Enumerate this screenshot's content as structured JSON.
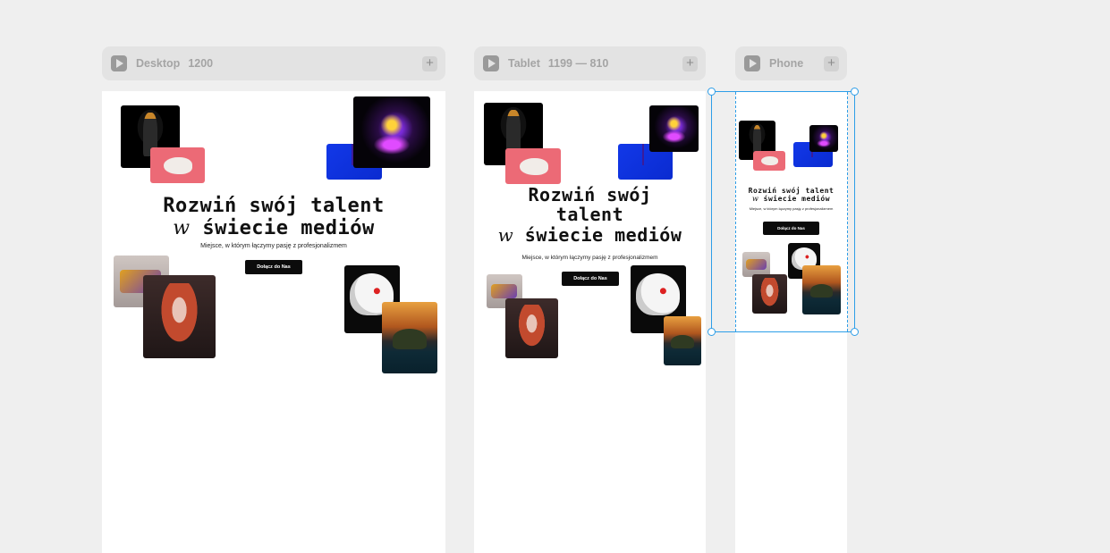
{
  "breakpoints": [
    {
      "title": "Desktop",
      "size": "1200"
    },
    {
      "title": "Tablet",
      "size": "1199 — 810"
    },
    {
      "title": "Phone",
      "size": ""
    }
  ],
  "hero": {
    "headline_line1": "Rozwiń swój talent",
    "headline_w": "w",
    "headline_line2": "świecie mediów",
    "tablet_line1": "Rozwiń swój",
    "tablet_line2": "talent",
    "subtitle": "Miejsce, w którym łączymy pasję z profesjonalizmem",
    "cta_label": "Dołącz do Nas"
  },
  "images": [
    "robot",
    "rat",
    "blue-glass",
    "magic-creature",
    "golden-car",
    "red-haired-woman",
    "skull",
    "island"
  ],
  "colors": {
    "canvas": "#efefef",
    "selection": "#2d9ee8",
    "cta": "#0b0b0b"
  }
}
